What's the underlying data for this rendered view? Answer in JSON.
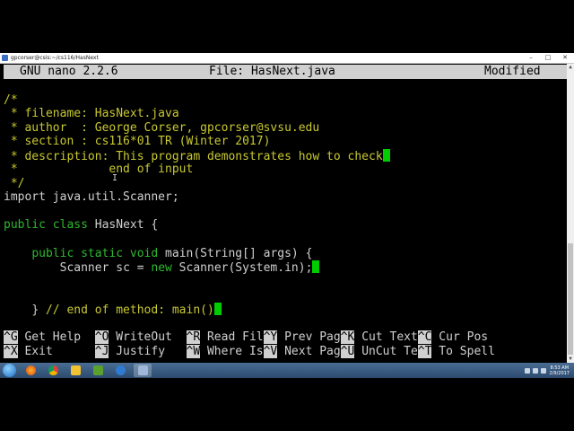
{
  "window": {
    "title": "gpcorser@csis:~/cs116/HasNext"
  },
  "nano": {
    "version": "GNU nano 2.2.6",
    "file_label": "File: HasNext.java",
    "status": "Modified"
  },
  "code": {
    "l1": "/*",
    "l2": " * filename: HasNext.java",
    "l3": " * author  : George Corser, gpcorser@svsu.edu",
    "l4": " * section : cs116*01 TR (Winter 2017)",
    "l5": " * description: This program demonstrates how to check",
    "l6": " *             end of input",
    "l7": " */",
    "l8": "import java.util.Scanner;",
    "l9_kw1": "public",
    "l9_kw2": "class",
    "l9_rest": " HasNext {",
    "l10_kw1": "public",
    "l10_kw2": "static",
    "l10_kw3": "void",
    "l10_rest": " main(String[] args) {",
    "l11_a": "Scanner sc = ",
    "l11_kw": "new",
    "l11_b": " Scanner(System.in);",
    "l12_a": "} ",
    "l12_comment": "// end of method: main()"
  },
  "shortcuts": {
    "row1": [
      {
        "key": "^G",
        "label": " Get Help  "
      },
      {
        "key": "^O",
        "label": " WriteOut  "
      },
      {
        "key": "^R",
        "label": " Read Fil"
      },
      {
        "key": "^Y",
        "label": " Prev Pag"
      },
      {
        "key": "^K",
        "label": " Cut Text"
      },
      {
        "key": "^C",
        "label": " Cur Pos"
      }
    ],
    "row2": [
      {
        "key": "^X",
        "label": " Exit      "
      },
      {
        "key": "^J",
        "label": " Justify   "
      },
      {
        "key": "^W",
        "label": " Where Is"
      },
      {
        "key": "^V",
        "label": " Next Pag"
      },
      {
        "key": "^U",
        "label": " UnCut Te"
      },
      {
        "key": "^T",
        "label": " To Spell"
      }
    ]
  },
  "taskbar": {
    "clock_time": "8:53 AM",
    "clock_date": "2/9/2017"
  },
  "colors": {
    "comment": "#c8c832",
    "keyword": "#2fb82f",
    "cursor": "#00cc00",
    "header_bg": "#d0d0d0"
  }
}
